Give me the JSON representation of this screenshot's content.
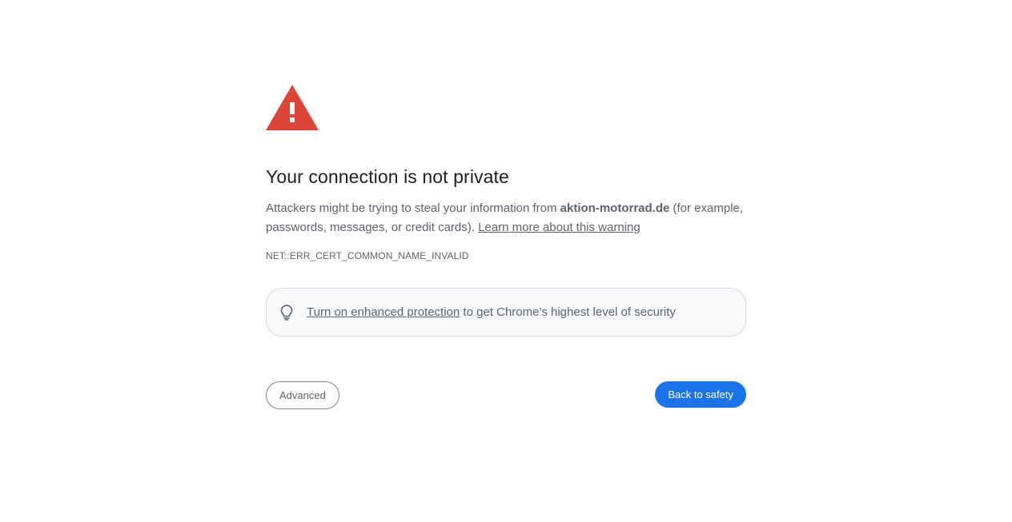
{
  "colors": {
    "warning_red": "#db4437",
    "primary_blue": "#1a73e8",
    "text_gray": "#5f6368",
    "title_dark": "#202124"
  },
  "icons": {
    "warning": "warning-triangle-icon",
    "protection": "lightbulb-icon"
  },
  "interstitial": {
    "title": "Your connection is not private",
    "explanation_prefix": "Attackers might be trying to steal your information from ",
    "domain": "aktion-motorrad.de",
    "explanation_suffix": " (for example, passwords, messages, or credit cards). ",
    "learn_more_label": "Learn more about this warning",
    "error_code": "NET::ERR_CERT_COMMON_NAME_INVALID"
  },
  "enhanced_protection": {
    "link_label": "Turn on enhanced protection",
    "text_suffix": " to get Chrome's highest level of security"
  },
  "buttons": {
    "advanced_label": "Advanced",
    "back_to_safety_label": "Back to safety"
  }
}
